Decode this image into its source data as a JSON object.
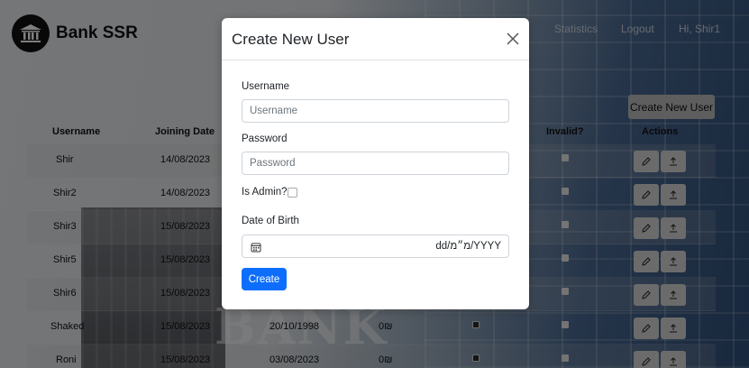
{
  "navbar": {
    "brand": "Bank SSR",
    "links": [
      "Statistics",
      "Logout",
      "Hi, Shir1"
    ],
    "logo_icon": "bank-building-icon"
  },
  "toolbar": {
    "create_label": "Create New User"
  },
  "table": {
    "headers": [
      "Username",
      "Joining Date",
      "Invalid?",
      "Actions"
    ],
    "rows": [
      {
        "username": "Shir",
        "joining": "14/08/2023",
        "dob": "",
        "balance": "",
        "admin": false,
        "invalid": false
      },
      {
        "username": "Shir2",
        "joining": "14/08/2023",
        "dob": "",
        "balance": "",
        "admin": false,
        "invalid": false
      },
      {
        "username": "Shir3",
        "joining": "15/08/2023",
        "dob": "",
        "balance": "",
        "admin": false,
        "invalid": false
      },
      {
        "username": "Shir5",
        "joining": "15/08/2023",
        "dob": "",
        "balance": "",
        "admin": false,
        "invalid": false
      },
      {
        "username": "Shir6",
        "joining": "15/08/2023",
        "dob": "",
        "balance": "",
        "admin": false,
        "invalid": false
      },
      {
        "username": "Shaked",
        "joining": "15/08/2023",
        "dob": "20/10/1998",
        "balance": "0₪",
        "admin": true,
        "invalid": false
      },
      {
        "username": "Roni",
        "joining": "15/08/2023",
        "dob": "03/08/2023",
        "balance": "0₪",
        "admin": true,
        "invalid": false
      }
    ],
    "action_icons": [
      "pencil-icon",
      "upload-icon"
    ]
  },
  "modal": {
    "title": "Create New User",
    "username_label": "Username",
    "username_placeholder": "Username",
    "password_label": "Password",
    "password_placeholder": "Password",
    "admin_label": "Is Admin?",
    "dob_label": "Date of Birth",
    "dob_value": "dd/מ״מ/YYYY",
    "submit_label": "Create"
  },
  "background": {
    "word": "BANK"
  },
  "colors": {
    "primary": "#0d6efd",
    "overlay": "rgba(0,0,0,0.5)"
  }
}
